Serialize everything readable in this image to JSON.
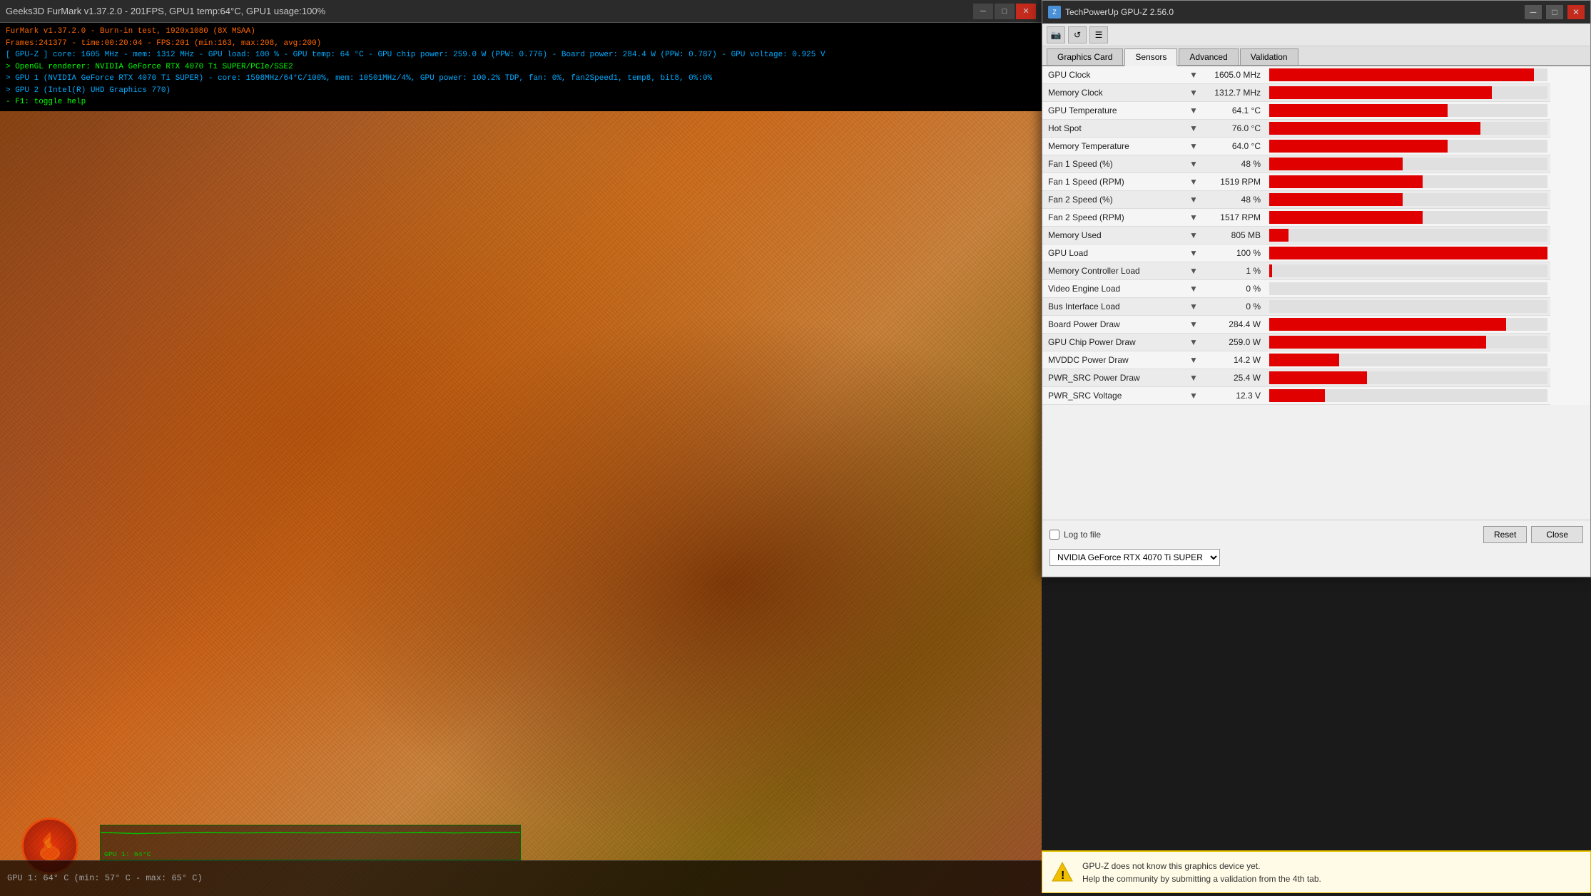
{
  "furmark": {
    "title": "Geeks3D FurMark v1.37.2.0 - 201FPS, GPU1 temp:64°C, GPU1 usage:100%",
    "info_line1": "FurMark v1.37.2.0 - Burn-in test, 1920x1080 (8X MSAA)",
    "info_line2": "Frames:241377 - time:00:20:04 - FPS:201 (min:163, max:208, avg:200)",
    "info_line3": "[ GPU-Z ] core: 1605 MHz - mem: 1312 MHz - GPU load: 100 % - GPU temp: 64 °C - GPU chip power: 259.0 W (PPW: 0.776) - Board power: 284.4 W (PPW: 0.787) - GPU voltage: 0.925 V",
    "info_line4": "> OpenGL renderer: NVIDIA GeForce RTX 4070 Ti SUPER/PCIe/SSE2",
    "info_line5": "> GPU 1 (NVIDIA GeForce RTX 4070 Ti SUPER) - core: 1598MHz/64°C/100%, mem: 10501MHz/4%, GPU power: 100.2% TDP, fan: 0%, fan2Speed1, temp8, bit8, 0%:0%",
    "info_line6": "> GPU 2 (Intel(R) UHD Graphics 770)",
    "info_line7": "- F1: toggle help",
    "gpu_temp_label": "GPU 1: 64° C (min: 57° C - max: 65° C)"
  },
  "gpuz": {
    "title": "TechPowerUp GPU-Z 2.56.0",
    "tabs": [
      "Graphics Card",
      "Sensors",
      "Advanced",
      "Validation"
    ],
    "active_tab": "Sensors",
    "sensors": [
      {
        "name": "GPU Clock",
        "value": "1605.0 MHz",
        "bar_pct": 95
      },
      {
        "name": "Memory Clock",
        "value": "1312.7 MHz",
        "bar_pct": 80
      },
      {
        "name": "GPU Temperature",
        "value": "64.1 °C",
        "bar_pct": 64
      },
      {
        "name": "Hot Spot",
        "value": "76.0 °C",
        "bar_pct": 76
      },
      {
        "name": "Memory Temperature",
        "value": "64.0 °C",
        "bar_pct": 64
      },
      {
        "name": "Fan 1 Speed (%)",
        "value": "48 %",
        "bar_pct": 48
      },
      {
        "name": "Fan 1 Speed (RPM)",
        "value": "1519 RPM",
        "bar_pct": 55
      },
      {
        "name": "Fan 2 Speed (%)",
        "value": "48 %",
        "bar_pct": 48
      },
      {
        "name": "Fan 2 Speed (RPM)",
        "value": "1517 RPM",
        "bar_pct": 55
      },
      {
        "name": "Memory Used",
        "value": "805 MB",
        "bar_pct": 7
      },
      {
        "name": "GPU Load",
        "value": "100 %",
        "bar_pct": 100
      },
      {
        "name": "Memory Controller Load",
        "value": "1 %",
        "bar_pct": 1
      },
      {
        "name": "Video Engine Load",
        "value": "0 %",
        "bar_pct": 0
      },
      {
        "name": "Bus Interface Load",
        "value": "0 %",
        "bar_pct": 0
      },
      {
        "name": "Board Power Draw",
        "value": "284.4 W",
        "bar_pct": 85
      },
      {
        "name": "GPU Chip Power Draw",
        "value": "259.0 W",
        "bar_pct": 78
      },
      {
        "name": "MVDDC Power Draw",
        "value": "14.2 W",
        "bar_pct": 25
      },
      {
        "name": "PWR_SRC Power Draw",
        "value": "25.4 W",
        "bar_pct": 35
      },
      {
        "name": "PWR_SRC Voltage",
        "value": "12.3 V",
        "bar_pct": 20
      }
    ],
    "gpu_selector": "NVIDIA GeForce RTX 4070 Ti SUPER",
    "log_label": "Log to file",
    "reset_btn": "Reset",
    "close_btn": "Close",
    "warning_line1": "GPU-Z does not know this graphics device yet.",
    "warning_line2": "Help the community by submitting a validation from the 4th tab."
  }
}
